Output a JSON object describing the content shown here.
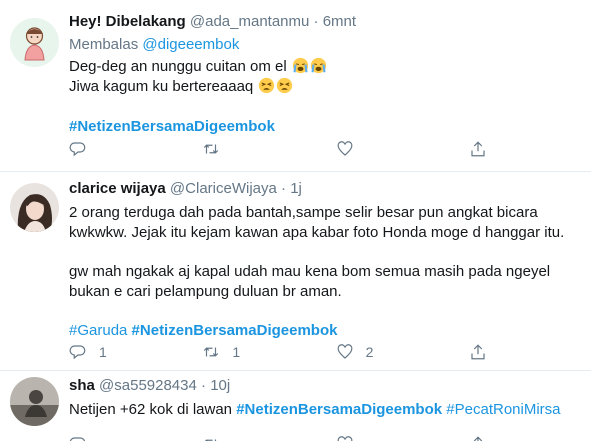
{
  "tweets": [
    {
      "name": "Hey! Dibelakang",
      "handle": "@ada_mantanmu",
      "sep": "·",
      "time": "6mnt",
      "reply_label": "Membalas",
      "reply_to": "@digeeembok",
      "line1": "Deg-deg an nunggu cuitan om el",
      "line2": "Jiwa kagum ku bertereaaaq",
      "hashtag": "#NetizenBersamaDigeembok",
      "counts": {
        "reply": "",
        "retweet": "",
        "like": ""
      }
    },
    {
      "name": "clarice wijaya",
      "handle": "@ClariceWijaya",
      "sep": "·",
      "time": "1j",
      "line1": "2 orang terduga dah pada bantah,sampe selir besar pun angkat bicara",
      "line2": "kwkwkw. Jejak itu kejam kawan apa kabar foto Honda moge d hanggar itu.",
      "line3": "gw mah ngakak aj kapal udah mau kena bom semua masih pada ngeyel",
      "line4": "bukan e cari pelampung duluan br aman.",
      "hashtag1": "#Garuda",
      "hashtag2": "#NetizenBersamaDigeembok",
      "counts": {
        "reply": "1",
        "retweet": "1",
        "like": "2"
      }
    },
    {
      "name": "sha",
      "handle": "@sa55928434",
      "sep": "·",
      "time": "10j",
      "text_prefix": "Netijen +62 kok di lawan",
      "hashtag1": "#NetizenBersamaDigeembok",
      "hashtag2": "#PecatRoniMirsa"
    }
  ],
  "icons": [
    "reply-icon",
    "retweet-icon",
    "like-icon",
    "share-icon",
    "crying-emoji",
    "tired-emoji"
  ],
  "colors": {
    "link": "#1b95e0",
    "muted": "#657786",
    "text": "#14171a",
    "divider": "#e6ecf0"
  }
}
